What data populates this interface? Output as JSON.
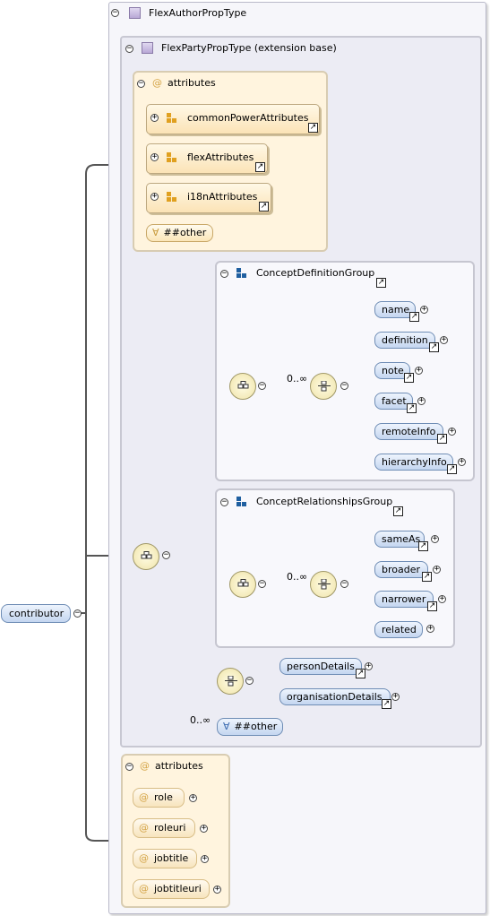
{
  "root": {
    "label": "contributor"
  },
  "type": {
    "label": "FlexAuthorPropType"
  },
  "base": {
    "label": "FlexPartyPropType (extension base)"
  },
  "attributes_top": {
    "header": "attributes",
    "groups": [
      "commonPowerAttributes",
      "flexAttributes",
      "i18nAttributes"
    ],
    "other": "##other"
  },
  "concept_definition": {
    "title": "ConceptDefinitionGroup",
    "cardinality": "0..∞",
    "elements": [
      "name",
      "definition",
      "note",
      "facet",
      "remoteInfo",
      "hierarchyInfo"
    ]
  },
  "concept_relationships": {
    "title": "ConceptRelationshipsGroup",
    "cardinality": "0..∞",
    "elements": [
      "sameAs",
      "broader",
      "narrower",
      "related"
    ]
  },
  "choice": {
    "elements": [
      "personDetails",
      "organisationDetails"
    ]
  },
  "any": {
    "cardinality": "0..∞",
    "label": "##other"
  },
  "attributes_bottom": {
    "header": "attributes",
    "items": [
      "role",
      "roleuri",
      "jobtitle",
      "jobtitleuri"
    ]
  },
  "glyphs": {
    "collapse": "−",
    "expand": "+",
    "at": "@",
    "infinity": "∞",
    "ref": "↗",
    "any": "∀"
  },
  "colors": {
    "element_fill": "#c4d6f0",
    "attribute_fill": "#f7e4bd",
    "compositor_fill": "#efe3a8",
    "line": "#555555"
  }
}
